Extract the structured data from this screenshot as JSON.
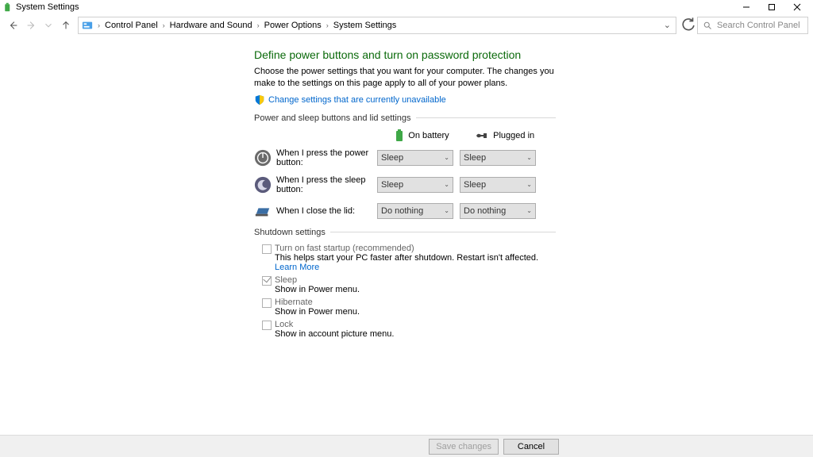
{
  "window": {
    "title": "System Settings"
  },
  "breadcrumbs": [
    "Control Panel",
    "Hardware and Sound",
    "Power Options",
    "System Settings"
  ],
  "search": {
    "placeholder": "Search Control Panel"
  },
  "page": {
    "heading": "Define power buttons and turn on password protection",
    "description": "Choose the power settings that you want for your computer. The changes you make to the settings on this page apply to all of your power plans.",
    "change_link": "Change settings that are currently unavailable",
    "section1": "Power and sleep buttons and lid settings",
    "cols": {
      "battery": "On battery",
      "plugged": "Plugged in"
    },
    "rows": [
      {
        "label": "When I press the power button:",
        "battery": "Sleep",
        "plugged": "Sleep"
      },
      {
        "label": "When I press the sleep button:",
        "battery": "Sleep",
        "plugged": "Sleep"
      },
      {
        "label": "When I close the lid:",
        "battery": "Do nothing",
        "plugged": "Do nothing"
      }
    ],
    "section2": "Shutdown settings",
    "checks": [
      {
        "name": "Turn on fast startup (recommended)",
        "desc_pre": "This helps start your PC faster after shutdown. Restart isn't affected. ",
        "desc_link": "Learn More",
        "checked": false
      },
      {
        "name": "Sleep",
        "desc_pre": "Show in Power menu.",
        "desc_link": "",
        "checked": true
      },
      {
        "name": "Hibernate",
        "desc_pre": "Show in Power menu.",
        "desc_link": "",
        "checked": false
      },
      {
        "name": "Lock",
        "desc_pre": "Show in account picture menu.",
        "desc_link": "",
        "checked": false
      }
    ]
  },
  "footer": {
    "save": "Save changes",
    "cancel": "Cancel"
  }
}
